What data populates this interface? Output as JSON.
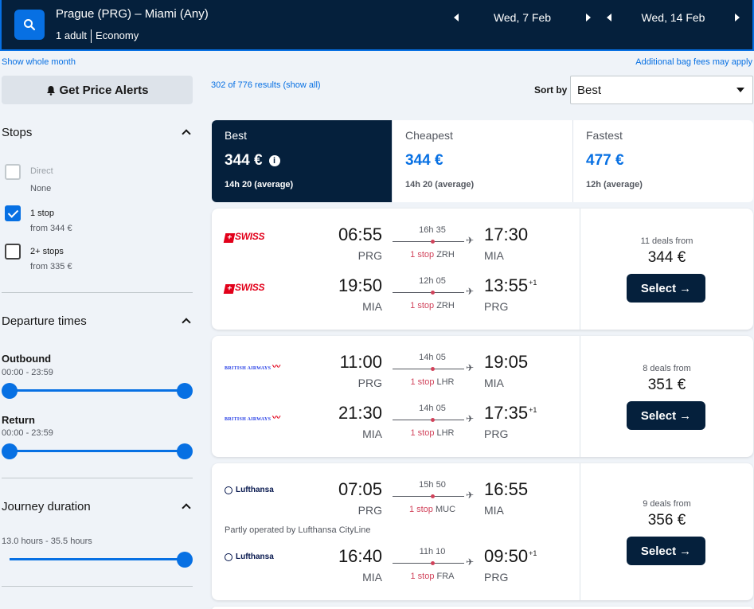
{
  "header": {
    "route": "Prague (PRG) – Miami (Any)",
    "passengers": "1 adult",
    "cabin": "Economy",
    "outbound_date": "Wed, 7 Feb",
    "return_date": "Wed, 14 Feb"
  },
  "top": {
    "show_month": "Show whole month",
    "bag_fees": "Additional bag fees may apply",
    "price_alerts": "Get Price Alerts",
    "results_count": "302 of 776 results (show all)",
    "sort_label": "Sort by",
    "sort_value": "Best"
  },
  "sidebar": {
    "stops_heading": "Stops",
    "stops": [
      {
        "label": "Direct",
        "sub": "None",
        "checked": false,
        "disabled": true
      },
      {
        "label": "1 stop",
        "sub": "from 344 €",
        "checked": true,
        "disabled": false
      },
      {
        "label": "2+ stops",
        "sub": "from 335 €",
        "checked": false,
        "disabled": false
      }
    ],
    "departure_heading": "Departure times",
    "outbound_label": "Outbound",
    "outbound_range": "00:00 - 23:59",
    "return_label": "Return",
    "return_range": "00:00 - 23:59",
    "duration_heading": "Journey duration",
    "duration_range": "13.0 hours - 35.5 hours"
  },
  "tabs": [
    {
      "label": "Best",
      "price": "344 €",
      "duration": "14h 20 (average)",
      "active": true
    },
    {
      "label": "Cheapest",
      "price": "344 €",
      "duration": "14h 20 (average)",
      "active": false
    },
    {
      "label": "Fastest",
      "price": "477 €",
      "duration": "12h (average)",
      "active": false
    }
  ],
  "results": [
    {
      "airline": "SWISS",
      "deals": "11 deals from",
      "price": "344 €",
      "select": "Select",
      "legs": [
        {
          "dep": "06:55",
          "dep_code": "PRG",
          "arr": "17:30",
          "arr_code": "MIA",
          "dur": "16h 35",
          "stops": "1 stop",
          "via": "ZRH",
          "plus": ""
        },
        {
          "dep": "19:50",
          "dep_code": "MIA",
          "arr": "13:55",
          "arr_code": "PRG",
          "dur": "12h 05",
          "stops": "1 stop",
          "via": "ZRH",
          "plus": "+1"
        }
      ]
    },
    {
      "airline": "BRITISH AIRWAYS",
      "deals": "8 deals from",
      "price": "351 €",
      "select": "Select",
      "legs": [
        {
          "dep": "11:00",
          "dep_code": "PRG",
          "arr": "19:05",
          "arr_code": "MIA",
          "dur": "14h 05",
          "stops": "1 stop",
          "via": "LHR",
          "plus": ""
        },
        {
          "dep": "21:30",
          "dep_code": "MIA",
          "arr": "17:35",
          "arr_code": "PRG",
          "dur": "14h 05",
          "stops": "1 stop",
          "via": "LHR",
          "plus": "+1"
        }
      ]
    },
    {
      "airline": "Lufthansa",
      "deals": "9 deals from",
      "price": "356 €",
      "select": "Select",
      "operated": "Partly operated by Lufthansa CityLine",
      "legs": [
        {
          "dep": "07:05",
          "dep_code": "PRG",
          "arr": "16:55",
          "arr_code": "MIA",
          "dur": "15h 50",
          "stops": "1 stop",
          "via": "MUC",
          "plus": ""
        },
        {
          "dep": "16:40",
          "dep_code": "MIA",
          "arr": "09:50",
          "arr_code": "PRG",
          "dur": "11h 10",
          "stops": "1 stop",
          "via": "FRA",
          "plus": "+1"
        }
      ]
    }
  ],
  "icons": {
    "search": "search-icon",
    "bell": "bell-icon",
    "info": "info-icon",
    "plane": "plane-icon",
    "arrow": "arrow-right-icon"
  },
  "colors": {
    "navy": "#05203c",
    "blue": "#0770e3",
    "stop_red": "#d1435b"
  }
}
